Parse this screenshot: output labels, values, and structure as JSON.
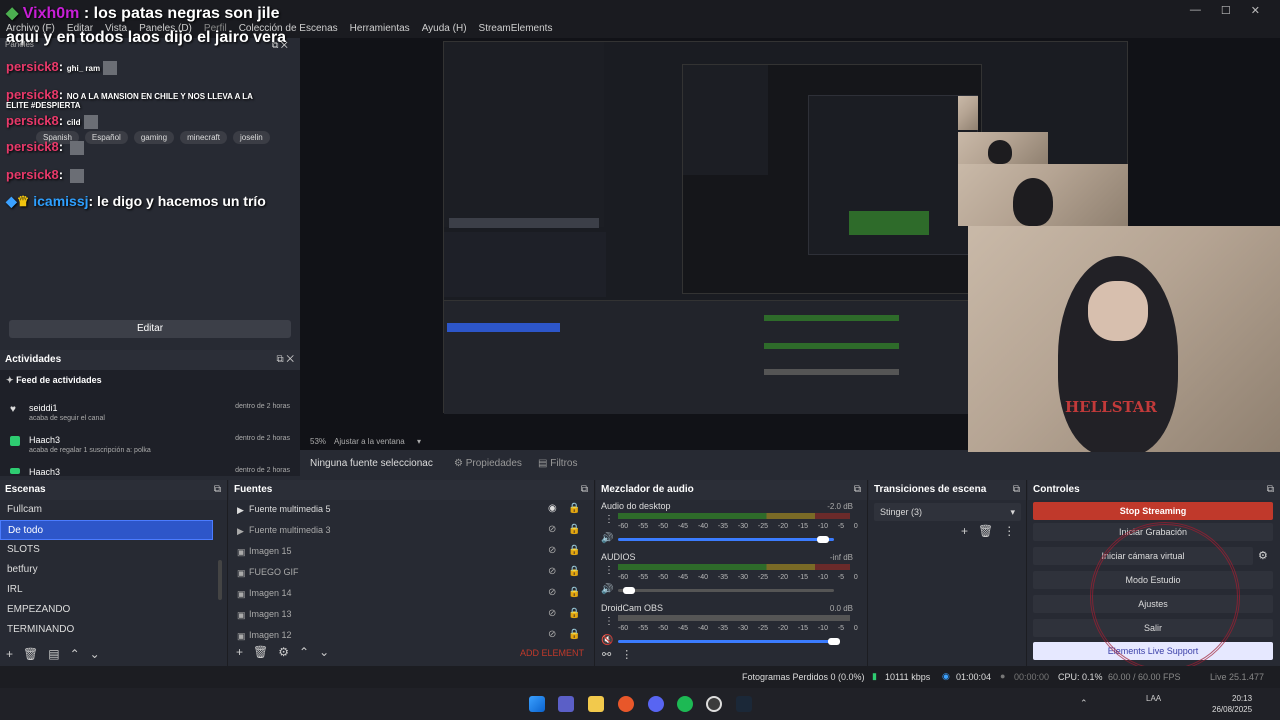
{
  "menu": [
    "Archivo (F)",
    "Editar",
    "Vista",
    "Paneles (D)",
    "Perfil",
    "Colección de Escenas",
    "Herramientas",
    "Ayuda (H)",
    "StreamElements"
  ],
  "chat": {
    "title_user": "Vixh0m",
    "title_text": ": los patas negras son jile",
    "line2": "aqui y en todos laos dijo el jairo vera",
    "paneles_label": "Paneles",
    "messages": [
      {
        "user": "persick8",
        "text": ": ",
        "extra": "ghi_ ram"
      },
      {
        "user": "persick8",
        "text": ": ",
        "extra": "NO A LA MANSION EN CHILE Y NOS LLEVA A LA"
      },
      {
        "user": "",
        "text": "ELITE #DESPIERTA",
        "extra": ""
      },
      {
        "user": "persick8",
        "text": ": ",
        "extra": "cild"
      },
      {
        "user": "persick8",
        "text": ": ",
        "extra": ""
      },
      {
        "user": "persick8",
        "text": ": ",
        "extra": ""
      },
      {
        "user": "icamissj",
        "text": ": le digo y hacemos un trío",
        "extra": ""
      }
    ],
    "tags": [
      "Spanish",
      "Español",
      "gaming",
      "minecraft",
      "joselin"
    ],
    "edit_button": "Editar"
  },
  "activities": {
    "title": "Actividades",
    "feed_title": "Feed de actividades",
    "items": [
      {
        "name": "seiddi1",
        "desc": "acaba de seguir el canal",
        "time": "dentro de 2 horas"
      },
      {
        "name": "Haach3",
        "desc": "acaba de regalar 1 suscripción a: polka",
        "time": "dentro de 2 horas"
      },
      {
        "name": "Haach3",
        "desc": "",
        "time": "dentro de 2 horas"
      }
    ]
  },
  "preview": {
    "zoom": "53%",
    "fit": "Ajustar a la ventana",
    "no_source": "Ninguna fuente seleccionac",
    "properties": "Propiedades",
    "filters": "Filtros"
  },
  "scenes": {
    "title": "Escenas",
    "items": [
      "Fullcam",
      "De todo",
      "SLOTS",
      "betfury",
      "IRL",
      "EMPEZANDO",
      "TERMINANDO"
    ],
    "selected": 1
  },
  "sources": {
    "title": "Fuentes",
    "items": [
      "Fuente multimedia 5",
      "Fuente multimedia 3",
      "Imagen 15",
      "FUEGO GIF",
      "Imagen 14",
      "Imagen 13",
      "Imagen 12"
    ],
    "add_element": "ADD ELEMENT"
  },
  "mixer": {
    "title": "Mezclador de audio",
    "channels": [
      {
        "name": "Audio do desktop",
        "db": "-2.0 dB",
        "level": 0.95
      },
      {
        "name": "AUDIOS",
        "db": "-inf dB",
        "level": 0.05
      },
      {
        "name": "DroidCam OBS",
        "db": "0.0 dB",
        "level": 1.0
      }
    ],
    "ticks": [
      "-60",
      "-55",
      "-50",
      "-45",
      "-40",
      "-35",
      "-30",
      "-25",
      "-20",
      "-15",
      "-10",
      "-5",
      "0"
    ]
  },
  "transitions": {
    "title": "Transiciones de escena",
    "selected": "Stinger (3)"
  },
  "controls": {
    "title": "Controles",
    "buttons": [
      "Stop Streaming",
      "Iniciar Grabación",
      "Iniciar cámara virtual",
      "Modo Estudio",
      "Ajustes",
      "Salir",
      "Elements Live Support"
    ]
  },
  "status": {
    "dropped": "Fotogramas Perdidos 0 (0.0%)",
    "kbps": "10111 kbps",
    "live_time": "01:00:04",
    "rec_time": "00:00:00",
    "cpu": "CPU: 0.1%",
    "fps": "60.00 / 60.00 FPS",
    "live_label": "Live 25.1.477"
  },
  "taskbar": {
    "time": "20:13",
    "date": "26/08/2025",
    "lang": "LAA"
  },
  "colors": {
    "stop_streaming": "#c0392b",
    "selected_scene": "#2d56c9",
    "live_support": "#e6e8ff"
  }
}
